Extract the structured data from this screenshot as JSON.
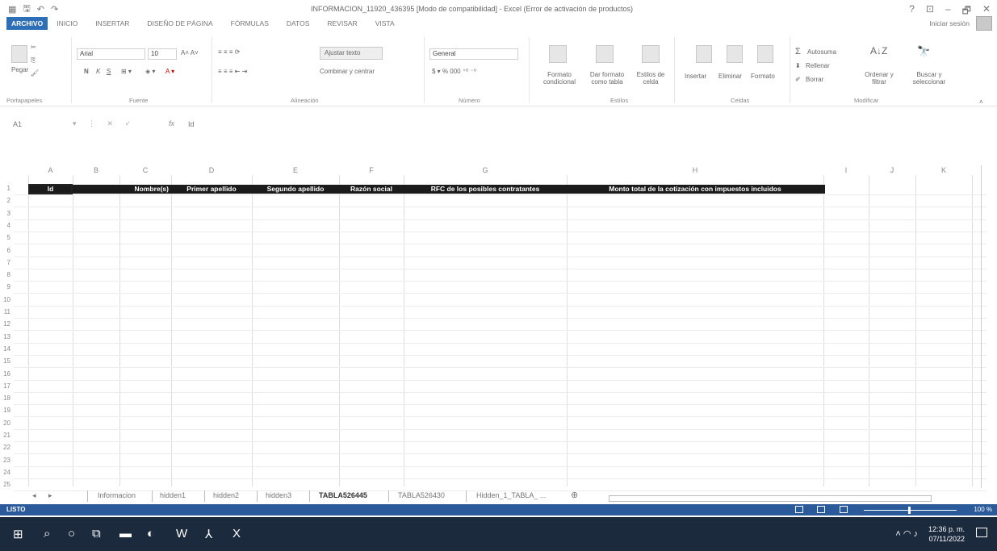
{
  "window": {
    "title": "INFORMACION_11920_436395 [Modo de compatibilidad] - Excel (Error de activación de productos)",
    "controls": [
      "?",
      "⊡",
      "–",
      "🗗",
      "✕"
    ]
  },
  "ribbon_tabs": [
    "ARCHIVO",
    "INICIO",
    "INSERTAR",
    "DISEÑO DE PÁGINA",
    "FÓRMULAS",
    "DATOS",
    "REVISAR",
    "VISTA"
  ],
  "signin": "Iniciar sesión",
  "ribbon": {
    "clipboard": {
      "paste": "Pegar",
      "label": "Portapapeles"
    },
    "font": {
      "name": "Arial",
      "size": "10",
      "bold": "N",
      "italic": "K",
      "underline": "S",
      "label": "Fuente"
    },
    "alignment": {
      "wrap": "Ajustar texto",
      "merge": "Combinar y centrar",
      "label": "Alineación"
    },
    "number": {
      "format": "General",
      "label": "Número"
    },
    "styles": {
      "cond": "Formato condicional",
      "table": "Dar formato como tabla",
      "cell": "Estilos de celda",
      "label": "Estilos"
    },
    "cells": {
      "insert": "Insertar",
      "delete": "Eliminar",
      "format": "Formato",
      "label": "Celdas"
    },
    "editing": {
      "autosum": "Autosuma",
      "fill": "Rellenar",
      "clear": "Borrar",
      "sort": "Ordenar y filtrar",
      "find": "Buscar y seleccionar",
      "label": "Modificar"
    }
  },
  "formula_bar": {
    "name_box": "A1",
    "fx": "fx",
    "value": "Id"
  },
  "columns": [
    "A",
    "B",
    "C",
    "D",
    "E",
    "F",
    "G",
    "H",
    "I",
    "J",
    "K"
  ],
  "rows": [
    "1",
    "2",
    "3",
    "4",
    "5",
    "6",
    "7",
    "8",
    "9",
    "10",
    "11",
    "12",
    "13",
    "14",
    "15",
    "16",
    "17",
    "18",
    "19",
    "20",
    "21",
    "22",
    "23",
    "24",
    "25"
  ],
  "header_row": {
    "A": "Id",
    "C": "Nombre(s)",
    "D": "Primer apellido",
    "E": "Segundo apellido",
    "F": "Razón social",
    "G": "RFC de los posibles contratantes",
    "H": "Monto total de la cotización con impuestos incluidos"
  },
  "sheet_tabs": [
    "Informacion",
    "hidden1",
    "hidden2",
    "hidden3",
    "TABLA526445",
    "TABLA526430",
    "Hidden_1_TABLA_ ..."
  ],
  "active_sheet": "TABLA526445",
  "status": {
    "text": "LISTO",
    "zoom": "100 %"
  },
  "taskbar": {
    "time": "12:36 p. m.",
    "date": "07/11/2022"
  }
}
